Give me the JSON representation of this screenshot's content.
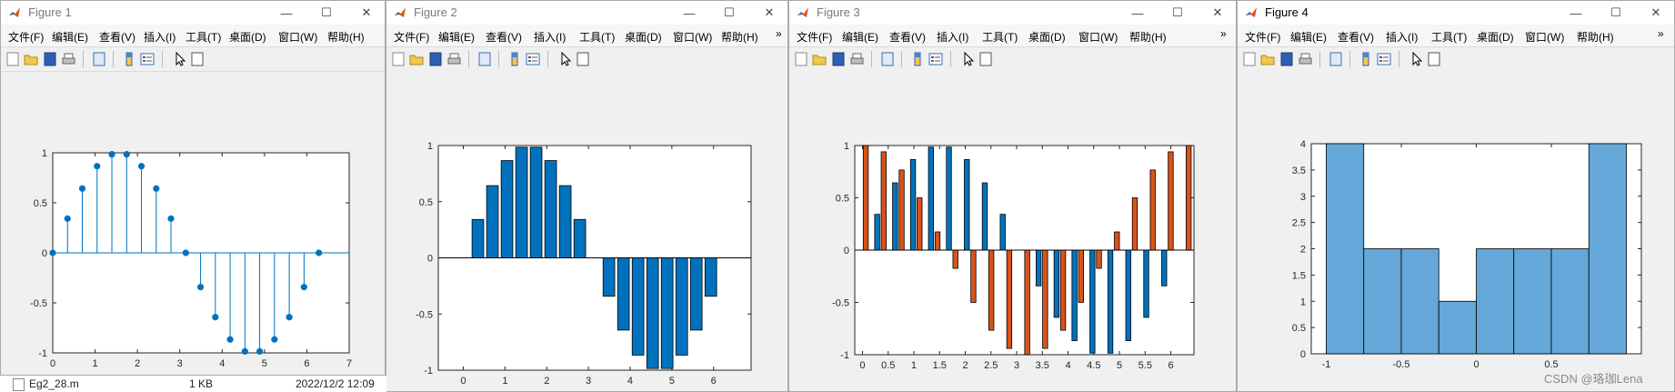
{
  "windows": [
    {
      "title": "Figure 1",
      "menu": [
        "文件(F)",
        "编辑(E)",
        "查看(V)",
        "插入(I)",
        "工具(T)",
        "桌面(D)",
        "窗口(W)",
        "帮助(H)"
      ],
      "axes": {
        "xlim": [
          0,
          7
        ],
        "ylim": [
          -1,
          1
        ],
        "xticks": [
          "0",
          "1",
          "2",
          "3",
          "4",
          "5",
          "6",
          "7"
        ],
        "yticks": [
          "-1",
          "-0.5",
          "0",
          "0.5",
          "1"
        ]
      }
    },
    {
      "title": "Figure 2",
      "menu": [
        "文件(F)",
        "编辑(E)",
        "查看(V)",
        "插入(I)",
        "工具(T)",
        "桌面(D)",
        "窗口(W)",
        "帮助(H)"
      ],
      "axes": {
        "xlim": [
          -0.6,
          6.9
        ],
        "ylim": [
          -1,
          1
        ],
        "xticks": [
          "0",
          "1",
          "2",
          "3",
          "4",
          "5",
          "6"
        ],
        "yticks": [
          "-1",
          "-0.5",
          "0",
          "0.5",
          "1"
        ]
      }
    },
    {
      "title": "Figure 3",
      "menu": [
        "文件(F)",
        "编辑(E)",
        "查看(V)",
        "插入(I)",
        "工具(T)",
        "桌面(D)",
        "窗口(W)",
        "帮助(H)"
      ],
      "axes": {
        "xlim": [
          -0.15,
          6.45
        ],
        "ylim": [
          -1,
          1
        ],
        "xticks": [
          "0",
          "0.5",
          "1",
          "1.5",
          "2",
          "2.5",
          "3",
          "3.5",
          "4",
          "4.5",
          "5",
          "5.5",
          "6"
        ],
        "yticks": [
          "-1",
          "-0.5",
          "0",
          "0.5",
          "1"
        ]
      }
    },
    {
      "title": "Figure 4",
      "menu": [
        "文件(F)",
        "编辑(E)",
        "查看(V)",
        "插入(I)",
        "工具(T)",
        "桌面(D)",
        "窗口(W)",
        "帮助(H)"
      ],
      "axes": {
        "xlim": [
          -1.1,
          1.1
        ],
        "ylim": [
          0,
          4
        ],
        "xticks": [
          "-1",
          "-0.5",
          "0",
          "0.5"
        ],
        "yticks": [
          "0",
          "0.5",
          "1",
          "1.5",
          "2",
          "2.5",
          "3",
          "3.5",
          "4"
        ]
      }
    }
  ],
  "file_row": {
    "name": "Eg2_28.m",
    "size": "1 KB",
    "date": "2022/12/2 12:09"
  },
  "watermark": "CSDN @珞珈Lena",
  "colors": {
    "stem": "#0072bd",
    "bar_blue": "#0072bd",
    "bar_orange": "#d95319",
    "hist": "#64a7d8"
  },
  "chart_data": [
    {
      "type": "scatter",
      "style": "stem",
      "x": [
        0,
        0.3491,
        0.6981,
        1.0472,
        1.3963,
        1.7453,
        2.0944,
        2.4435,
        2.7925,
        3.1416,
        3.4907,
        3.8397,
        4.1888,
        4.5379,
        4.8869,
        5.236,
        5.5851,
        5.9341,
        6.2832
      ],
      "y": [
        0,
        0.342,
        0.643,
        0.866,
        0.985,
        0.985,
        0.866,
        0.643,
        0.342,
        0,
        -0.342,
        -0.643,
        -0.866,
        -0.985,
        -0.985,
        -0.866,
        -0.643,
        -0.342,
        0
      ],
      "xlim": [
        0,
        7
      ],
      "ylim": [
        -1,
        1
      ]
    },
    {
      "type": "bar",
      "x": [
        0,
        0.3491,
        0.6981,
        1.0472,
        1.3963,
        1.7453,
        2.0944,
        2.4435,
        2.7925,
        3.1416,
        3.4907,
        3.8397,
        4.1888,
        4.5379,
        4.8869,
        5.236,
        5.5851,
        5.9341,
        6.2832
      ],
      "values": [
        0,
        0.342,
        0.643,
        0.866,
        0.985,
        0.985,
        0.866,
        0.643,
        0.342,
        0,
        -0.342,
        -0.643,
        -0.866,
        -0.985,
        -0.985,
        -0.866,
        -0.643,
        -0.342,
        0
      ],
      "ylim": [
        -1,
        1
      ]
    },
    {
      "type": "bar",
      "grouped": true,
      "x": [
        0,
        0.3491,
        0.6981,
        1.0472,
        1.3963,
        1.7453,
        2.0944,
        2.4435,
        2.7925,
        3.1416,
        3.4907,
        3.8397,
        4.1888,
        4.5379,
        4.8869,
        5.236,
        5.5851,
        5.9341,
        6.2832
      ],
      "series": [
        {
          "values": [
            0,
            0.342,
            0.643,
            0.866,
            0.985,
            0.985,
            0.866,
            0.643,
            0.342,
            0,
            -0.342,
            -0.643,
            -0.866,
            -0.985,
            -0.985,
            -0.866,
            -0.643,
            -0.342,
            0
          ]
        },
        {
          "values": [
            1,
            0.94,
            0.766,
            0.5,
            0.174,
            -0.174,
            -0.5,
            -0.766,
            -0.94,
            -1,
            -0.94,
            -0.766,
            -0.5,
            -0.174,
            0.174,
            0.5,
            0.766,
            0.94,
            1
          ]
        }
      ],
      "ylim": [
        -1,
        1
      ]
    },
    {
      "type": "bar",
      "style": "histogram",
      "bin_edges": [
        -1,
        -0.8,
        -0.6,
        -0.4,
        -0.2,
        0,
        0.2,
        0.4,
        0.6,
        0.8,
        1
      ],
      "values": [
        4,
        2,
        2,
        1,
        2,
        2,
        2,
        4
      ],
      "bins": [
        [
          -1,
          -0.75
        ],
        [
          -0.75,
          -0.5
        ],
        [
          -0.5,
          -0.25
        ],
        [
          -0.25,
          0
        ],
        [
          0,
          0.25
        ],
        [
          0.25,
          0.5
        ],
        [
          0.5,
          0.75
        ],
        [
          0.75,
          1
        ]
      ],
      "ylim": [
        0,
        4
      ]
    }
  ]
}
